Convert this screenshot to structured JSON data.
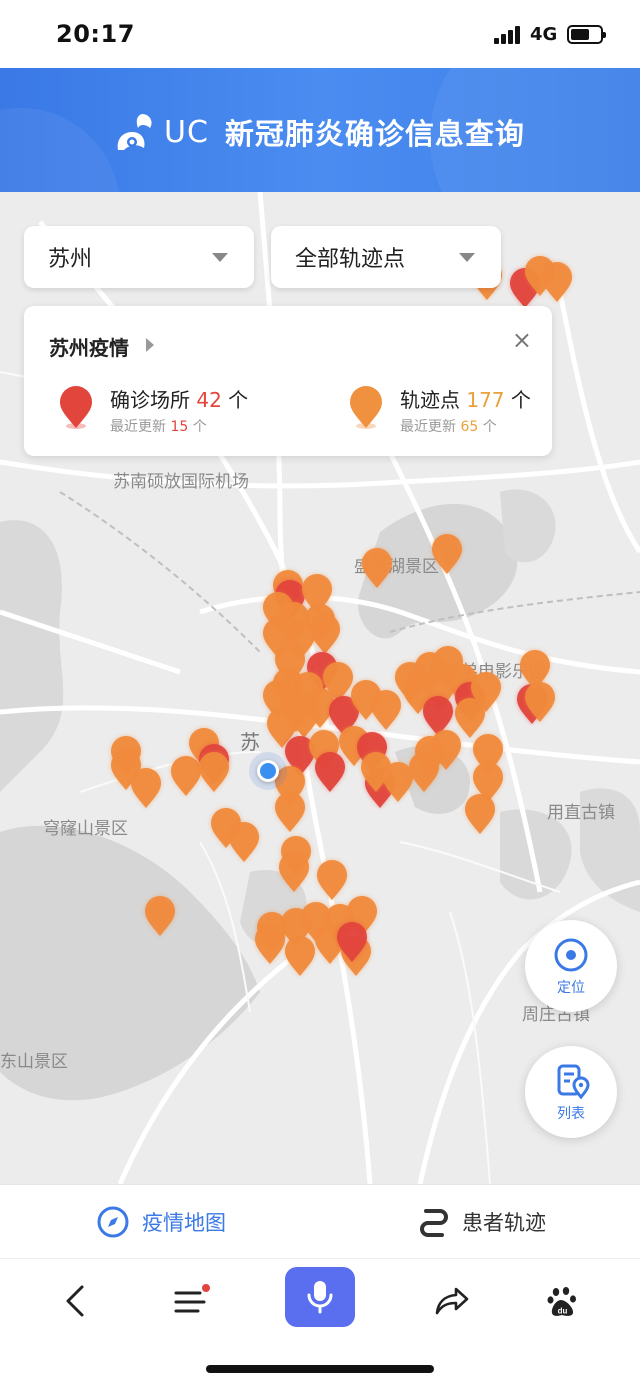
{
  "status_bar": {
    "time": "20:17",
    "network": "4G"
  },
  "header": {
    "brand": "UC",
    "title": "新冠肺炎确诊信息查询"
  },
  "filters": {
    "city": "苏州",
    "type": "全部轨迹点"
  },
  "info_card": {
    "title": "苏州疫情",
    "confirmed": {
      "label": "确诊场所",
      "count": "42",
      "unit": "个",
      "update_prefix": "最近更新",
      "update_count": "15",
      "update_unit": "个"
    },
    "track": {
      "label": "轨迹点",
      "count": "177",
      "unit": "个",
      "update_prefix": "最近更新",
      "update_count": "65",
      "update_unit": "个"
    }
  },
  "map_labels": {
    "airport": "苏南硕放国际机场",
    "lake_park": "盛泽湖景区",
    "studio": "华谊兄弟电影乐园",
    "city": "苏",
    "qionglong": "穹窿山景区",
    "yongzhi": "用直古镇",
    "dongshan": "东山景区",
    "zhouzhuang": "周庄古镇"
  },
  "map_buttons": {
    "locate": "定位",
    "list": "列表"
  },
  "tabs": {
    "map": "疫情地图",
    "patient": "患者轨迹"
  },
  "colors": {
    "header_blue": "#3a79e6",
    "confirmed_red": "#e2453c",
    "track_orange": "#f08a3c",
    "tab_active": "#3a79e6",
    "mic_bg": "#5a6ef0"
  },
  "icons": {
    "locate": "locate-icon",
    "list": "list-location-icon",
    "map_tab": "compass-icon",
    "patient_tab": "route-icon",
    "back": "back-icon",
    "menu": "menu-icon",
    "mic": "mic-icon",
    "share": "share-icon",
    "baidu": "baidu-paw-icon"
  }
}
